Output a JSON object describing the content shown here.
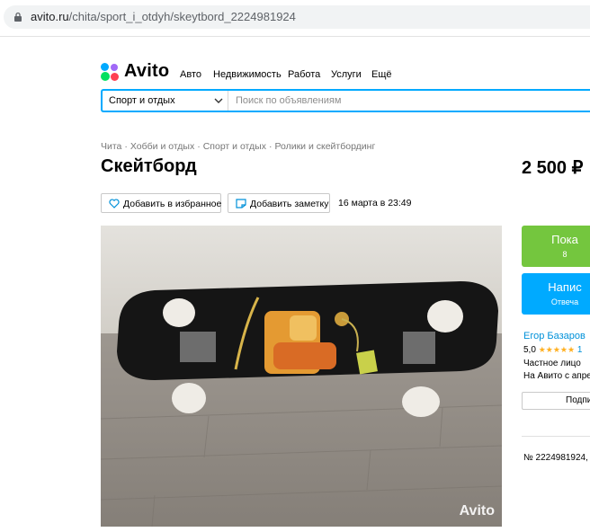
{
  "browser": {
    "url_host": "avito.ru",
    "url_path": "/chita/sport_i_otdyh/skeytbord_2224981924"
  },
  "header": {
    "logo_text": "Avito",
    "nav": [
      "Авто",
      "Недвижимость",
      "Работа",
      "Услуги",
      "Ещё"
    ],
    "search": {
      "category": "Спорт и отдых",
      "placeholder": "Поиск по объявлениям"
    }
  },
  "breadcrumb": [
    "Чита",
    "Хобби и отдых",
    "Спорт и отдых",
    "Ролики и скейтбординг"
  ],
  "listing": {
    "title": "Скейтборд",
    "price": "2 500 ₽",
    "favorite_label": "Добавить в избранное",
    "note_label": "Добавить заметку",
    "date": "16 марта в 23:49",
    "photo_watermark": "Avito",
    "ad_number": "№ 2224981924,"
  },
  "sidebar": {
    "show_phone": {
      "line1": "Пока",
      "line2": "8"
    },
    "write": {
      "line1": "Напис",
      "line2": "Отвеча"
    },
    "seller_name": "Егор Базаров",
    "rating_value": "5,0",
    "stars": "★★★★★",
    "rating_count": "1",
    "seller_type": "Частное лицо",
    "on_avito_since": "На Авито с апре",
    "subscribe_label": "Подпи"
  },
  "colors": {
    "green": "#74c63e",
    "blue": "#00aaff",
    "link": "#0091d9"
  }
}
